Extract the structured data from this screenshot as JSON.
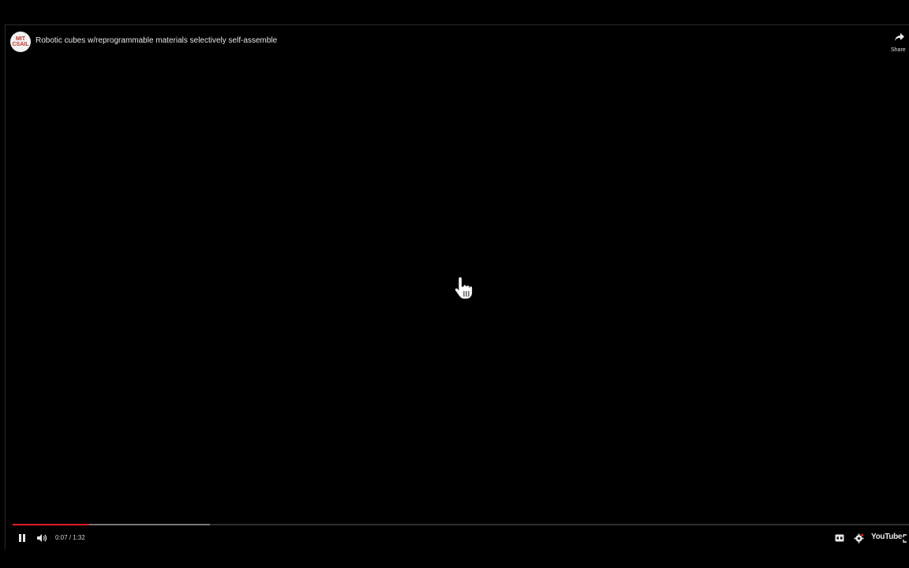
{
  "video": {
    "title": "Robotic cubes w/reprogrammable materials selectively self-assemble",
    "channel_avatar_text": "MIT CSAIL",
    "share_label": "Share"
  },
  "playback": {
    "current_time": "0:07",
    "separator": " / ",
    "duration": "1:32",
    "played_fraction": 0.085,
    "buffered_fraction": 0.22,
    "state": "playing"
  },
  "controls": {
    "right_brand": "YouTube"
  },
  "icons": [
    "pause-icon",
    "volume-icon",
    "captions-icon",
    "settings-icon",
    "fullscreen-icon",
    "share-icon",
    "hand-cursor-icon"
  ],
  "colors": {
    "background": "#000000",
    "progress_played": "#e21b23"
  }
}
